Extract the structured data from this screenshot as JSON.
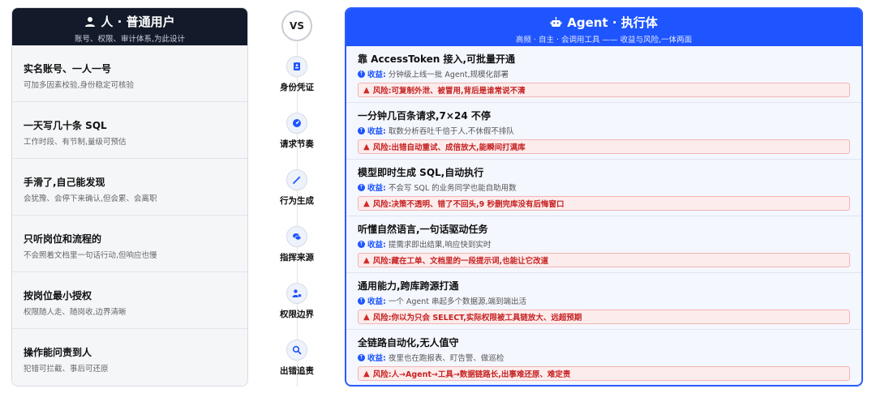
{
  "left": {
    "title": "人 · 普通用户",
    "subtitle": "账号、权限、审计体系,为此设计",
    "rows": [
      {
        "title": "实名账号、一人一号",
        "desc": "可加多因素校验,身份稳定可核验"
      },
      {
        "title": "一天写几十条 SQL",
        "desc": "工作时段、有节制,量级可预估"
      },
      {
        "title": "手滑了,自己能发现",
        "desc": "会犹豫、会停下来确认,但会累、会离职"
      },
      {
        "title": "只听岗位和流程的",
        "desc": "不会照着文档里一句话行动,但响应也慢"
      },
      {
        "title": "按岗位最小授权",
        "desc": "权限随人走、随岗收,边界清晰"
      },
      {
        "title": "操作能问责到人",
        "desc": "犯错可拦截、事后可还原"
      }
    ]
  },
  "middle": {
    "vs": "VS",
    "items": [
      {
        "label": "身份凭证",
        "icon": "id-card-icon"
      },
      {
        "label": "请求节奏",
        "icon": "speed-icon"
      },
      {
        "label": "行为生成",
        "icon": "magic-wand-icon"
      },
      {
        "label": "指挥来源",
        "icon": "chat-icon"
      },
      {
        "label": "权限边界",
        "icon": "user-lock-icon"
      },
      {
        "label": "出错追责",
        "icon": "search-icon"
      }
    ]
  },
  "right": {
    "title": "Agent · 执行体",
    "subtitle": "高频 · 自主 · 会调用工具 —— 收益与风险,一体两面",
    "gain_label": "收益:",
    "risk_label": "风险:",
    "rows": [
      {
        "title": "靠 AccessToken 接入,可批量开通",
        "gain": "分钟级上线一批 Agent,规模化部署",
        "risk": "可复制外泄、被冒用,背后是谁常说不清"
      },
      {
        "title": "一分钟几百条请求,7×24 不停",
        "gain": "取数分析吞吐千倍于人,不休假不排队",
        "risk": "出错自动重试、成倍放大,能瞬间打满库"
      },
      {
        "title": "模型即时生成 SQL,自动执行",
        "gain": "不会写 SQL 的业务同学也能自助用数",
        "risk": "决策不透明、错了不回头,9 秒删完库没有后悔窗口"
      },
      {
        "title": "听懂自然语言,一句话驱动任务",
        "gain": "提需求即出结果,响应快到实时",
        "risk": "藏在工单、文档里的一段提示词,也能让它改道"
      },
      {
        "title": "通用能力,跨库跨源打通",
        "gain": "一个 Agent 串起多个数据源,端到端出活",
        "risk": "你以为只会 SELECT,实际权限被工具链放大、远超预期"
      },
      {
        "title": "全链路自动化,无人值守",
        "gain": "夜里也在跑报表、盯告警、做巡检",
        "risk": "人→Agent→工具→数据链路长,出事难还原、难定责"
      }
    ]
  },
  "colors": {
    "accent": "#1f55ff",
    "dark": "#131a2a",
    "risk": "#c62222"
  }
}
